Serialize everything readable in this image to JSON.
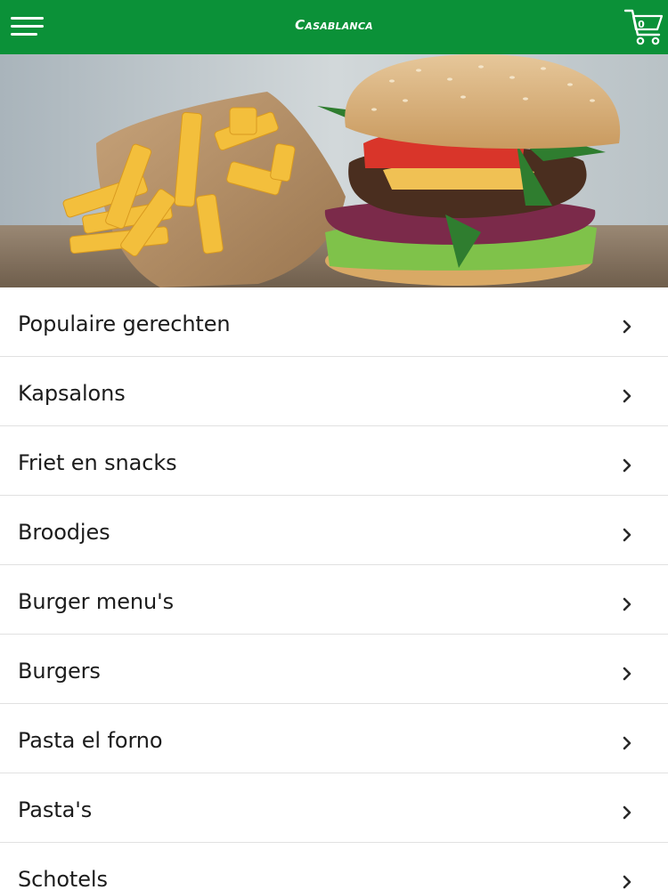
{
  "header": {
    "brand": "Casablanca",
    "menu_icon": "hamburger-menu-icon",
    "cart_icon": "shopping-cart-icon",
    "cart_count": "0",
    "background_color": "#0b9138",
    "brand_color": "#ffffff"
  },
  "hero": {
    "image_content": "burger-and-fries-photo"
  },
  "categories": {
    "chevron_icon": "chevron-right-icon",
    "items": [
      {
        "label": "Populaire gerechten"
      },
      {
        "label": "Kapsalons"
      },
      {
        "label": "Friet en snacks"
      },
      {
        "label": "Broodjes"
      },
      {
        "label": "Burger menu's"
      },
      {
        "label": "Burgers"
      },
      {
        "label": "Pasta el forno"
      },
      {
        "label": "Pasta's"
      },
      {
        "label": "Schotels"
      }
    ]
  }
}
